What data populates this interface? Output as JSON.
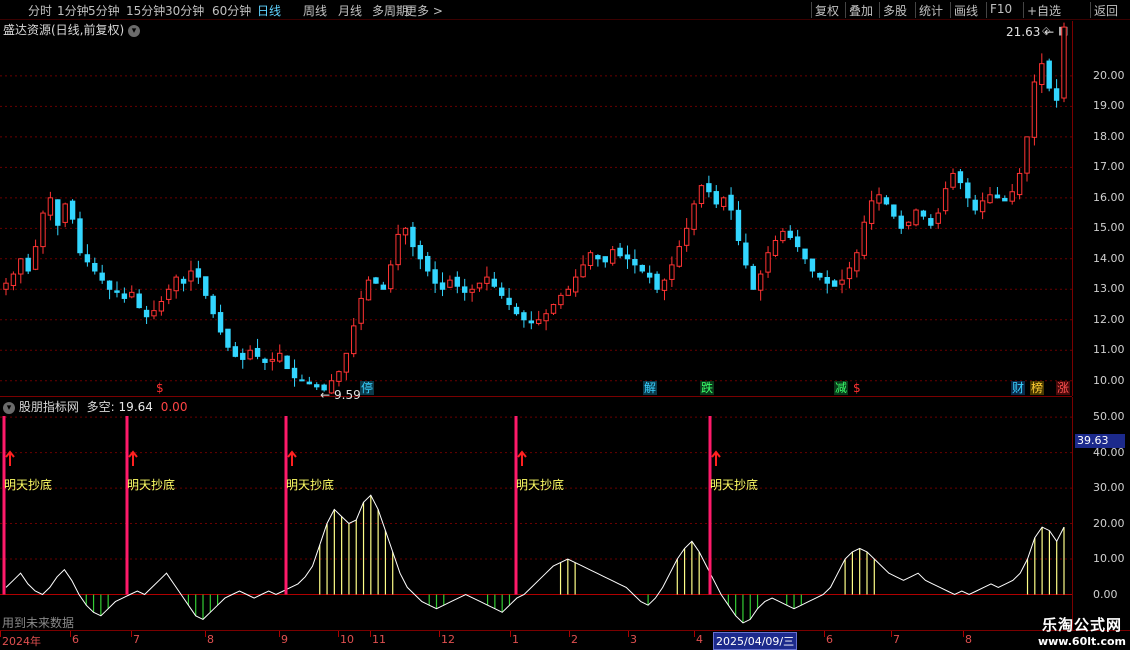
{
  "toolbar": {
    "left": [
      "分时",
      "1分钟",
      "5分钟",
      "15分钟",
      "30分钟",
      "60分钟",
      "日线",
      "周线",
      "月线",
      "多周期",
      "更多 >"
    ],
    "active_index": 6,
    "right": [
      "复权",
      "叠加",
      "多股",
      "统计",
      "画线",
      "F10",
      "+自选",
      "返回"
    ]
  },
  "main": {
    "title": "盛达资源(日线,前复权)",
    "high_label": "21.63",
    "low_label": "9.59",
    "price_ticks": [
      "20.00",
      "19.00",
      "18.00",
      "17.00",
      "16.00",
      "15.00",
      "14.00",
      "13.00",
      "12.00",
      "11.00",
      "10.00"
    ],
    "events": [
      {
        "text": "$",
        "color": "#ff3030",
        "bg": "transparent"
      },
      {
        "text": "停",
        "color": "#3ad0ff",
        "bg": "#0a3a4a"
      },
      {
        "text": "解",
        "color": "#3ad0ff",
        "bg": "#0a3a4a"
      },
      {
        "text": "跌",
        "color": "#3aff6a",
        "bg": "#0a3a1a"
      },
      {
        "text": "减",
        "color": "#3aff6a",
        "bg": "#0a3a1a"
      },
      {
        "text": "$",
        "color": "#ff3030",
        "bg": "transparent"
      },
      {
        "text": "财",
        "color": "#3ad0ff",
        "bg": "#0a2a4a"
      },
      {
        "text": "榜",
        "color": "#ffcc33",
        "bg": "#4a3a00"
      },
      {
        "text": "涨",
        "color": "#ff5050",
        "bg": "#4a0a0a"
      }
    ]
  },
  "indicator": {
    "name": "股朋指标网",
    "series_label": "多空:",
    "value1": "19.64",
    "value2": "0.00",
    "ticks": [
      "50.00",
      "40.00",
      "30.00",
      "20.00",
      "10.00",
      "0.00"
    ],
    "readout": "39.63",
    "signal_text": "明天抄底",
    "future_note": "用到未来数据"
  },
  "date_axis": {
    "labels": [
      "2024年",
      "6",
      "7",
      "8",
      "9",
      "10",
      "11",
      "12",
      "1",
      "2",
      "3",
      "4",
      "6",
      "7",
      "8"
    ],
    "cursor_date": "2025/04/09/三"
  },
  "watermark": {
    "line1": "乐淘公式网",
    "line2": "www.60lt.com"
  },
  "colors": {
    "up": "#ff3333",
    "down": "#33d6ff",
    "signal": "#ff1a6a",
    "line": "#ffffff",
    "pos_bar": "#ffff88",
    "neg_bar": "#33cc33",
    "grid": "#6a0000"
  },
  "chart_data": {
    "type": "candlestick+indicator",
    "price_ylim": [
      9.5,
      21.8
    ],
    "indicator_ylim": [
      -10,
      52
    ],
    "price_close": [
      13.2,
      13.5,
      14.0,
      13.6,
      14.4,
      15.5,
      16.0,
      15.1,
      15.8,
      15.3,
      14.2,
      13.9,
      13.6,
      13.3,
      13.0,
      12.9,
      12.7,
      12.9,
      12.4,
      12.1,
      12.3,
      12.6,
      13.0,
      13.4,
      13.2,
      13.6,
      13.4,
      12.8,
      12.2,
      11.6,
      11.1,
      10.8,
      10.7,
      11.0,
      10.8,
      10.6,
      10.7,
      10.9,
      10.4,
      10.1,
      10.0,
      9.9,
      9.8,
      9.7,
      10.0,
      10.3,
      10.9,
      11.8,
      12.7,
      13.3,
      13.2,
      13.0,
      13.8,
      14.8,
      15.0,
      14.4,
      14.0,
      13.6,
      13.2,
      13.0,
      13.3,
      13.1,
      12.9,
      13.0,
      13.2,
      13.4,
      13.1,
      12.8,
      12.5,
      12.2,
      12.0,
      11.9,
      12.0,
      12.2,
      12.5,
      12.8,
      13.0,
      13.4,
      13.8,
      14.2,
      14.0,
      13.9,
      14.3,
      14.1,
      14.0,
      13.8,
      13.6,
      13.4,
      13.0,
      13.3,
      13.8,
      14.4,
      15.0,
      15.8,
      16.4,
      16.2,
      15.8,
      16.0,
      15.6,
      14.6,
      13.8,
      13.0,
      13.5,
      14.2,
      14.6,
      14.9,
      14.7,
      14.4,
      14.0,
      13.6,
      13.4,
      13.2,
      13.1,
      13.3,
      13.7,
      14.2,
      15.2,
      15.9,
      16.1,
      15.8,
      15.4,
      15.0,
      15.2,
      15.6,
      15.4,
      15.1,
      15.5,
      16.3,
      16.8,
      16.5,
      16.0,
      15.6,
      15.9,
      16.1,
      16.0,
      15.9,
      16.2,
      16.8,
      18.0,
      19.8,
      20.4,
      19.6,
      19.2,
      21.6
    ],
    "indicator": [
      2,
      4,
      6,
      3,
      1,
      0,
      2,
      5,
      7,
      4,
      0,
      -3,
      -5,
      -6,
      -4,
      -2,
      -1,
      0,
      1,
      0,
      2,
      4,
      6,
      3,
      0,
      -3,
      -6,
      -7,
      -5,
      -3,
      -1,
      0,
      1,
      0,
      -1,
      0,
      1,
      0,
      1,
      2,
      3,
      5,
      8,
      14,
      20,
      24,
      22,
      20,
      21,
      26,
      28,
      24,
      18,
      12,
      6,
      2,
      0,
      -2,
      -3,
      -4,
      -3,
      -2,
      -1,
      0,
      -1,
      -2,
      -3,
      -4,
      -5,
      -3,
      -1,
      0,
      2,
      4,
      6,
      8,
      9,
      10,
      9,
      8,
      7,
      6,
      5,
      4,
      3,
      2,
      0,
      -2,
      -3,
      -1,
      2,
      6,
      10,
      13,
      15,
      12,
      8,
      4,
      0,
      -3,
      -6,
      -8,
      -7,
      -4,
      -2,
      -1,
      -2,
      -3,
      -4,
      -3,
      -2,
      -1,
      0,
      2,
      6,
      10,
      12,
      13,
      12,
      10,
      8,
      6,
      5,
      4,
      5,
      6,
      4,
      3,
      2,
      1,
      0,
      1,
      0,
      1,
      2,
      3,
      2,
      3,
      4,
      6,
      10,
      16,
      19,
      18,
      15,
      19
    ],
    "signals": [
      "2024-05",
      "2024-07",
      "2024-09",
      "2025-01",
      "2025-04"
    ]
  }
}
